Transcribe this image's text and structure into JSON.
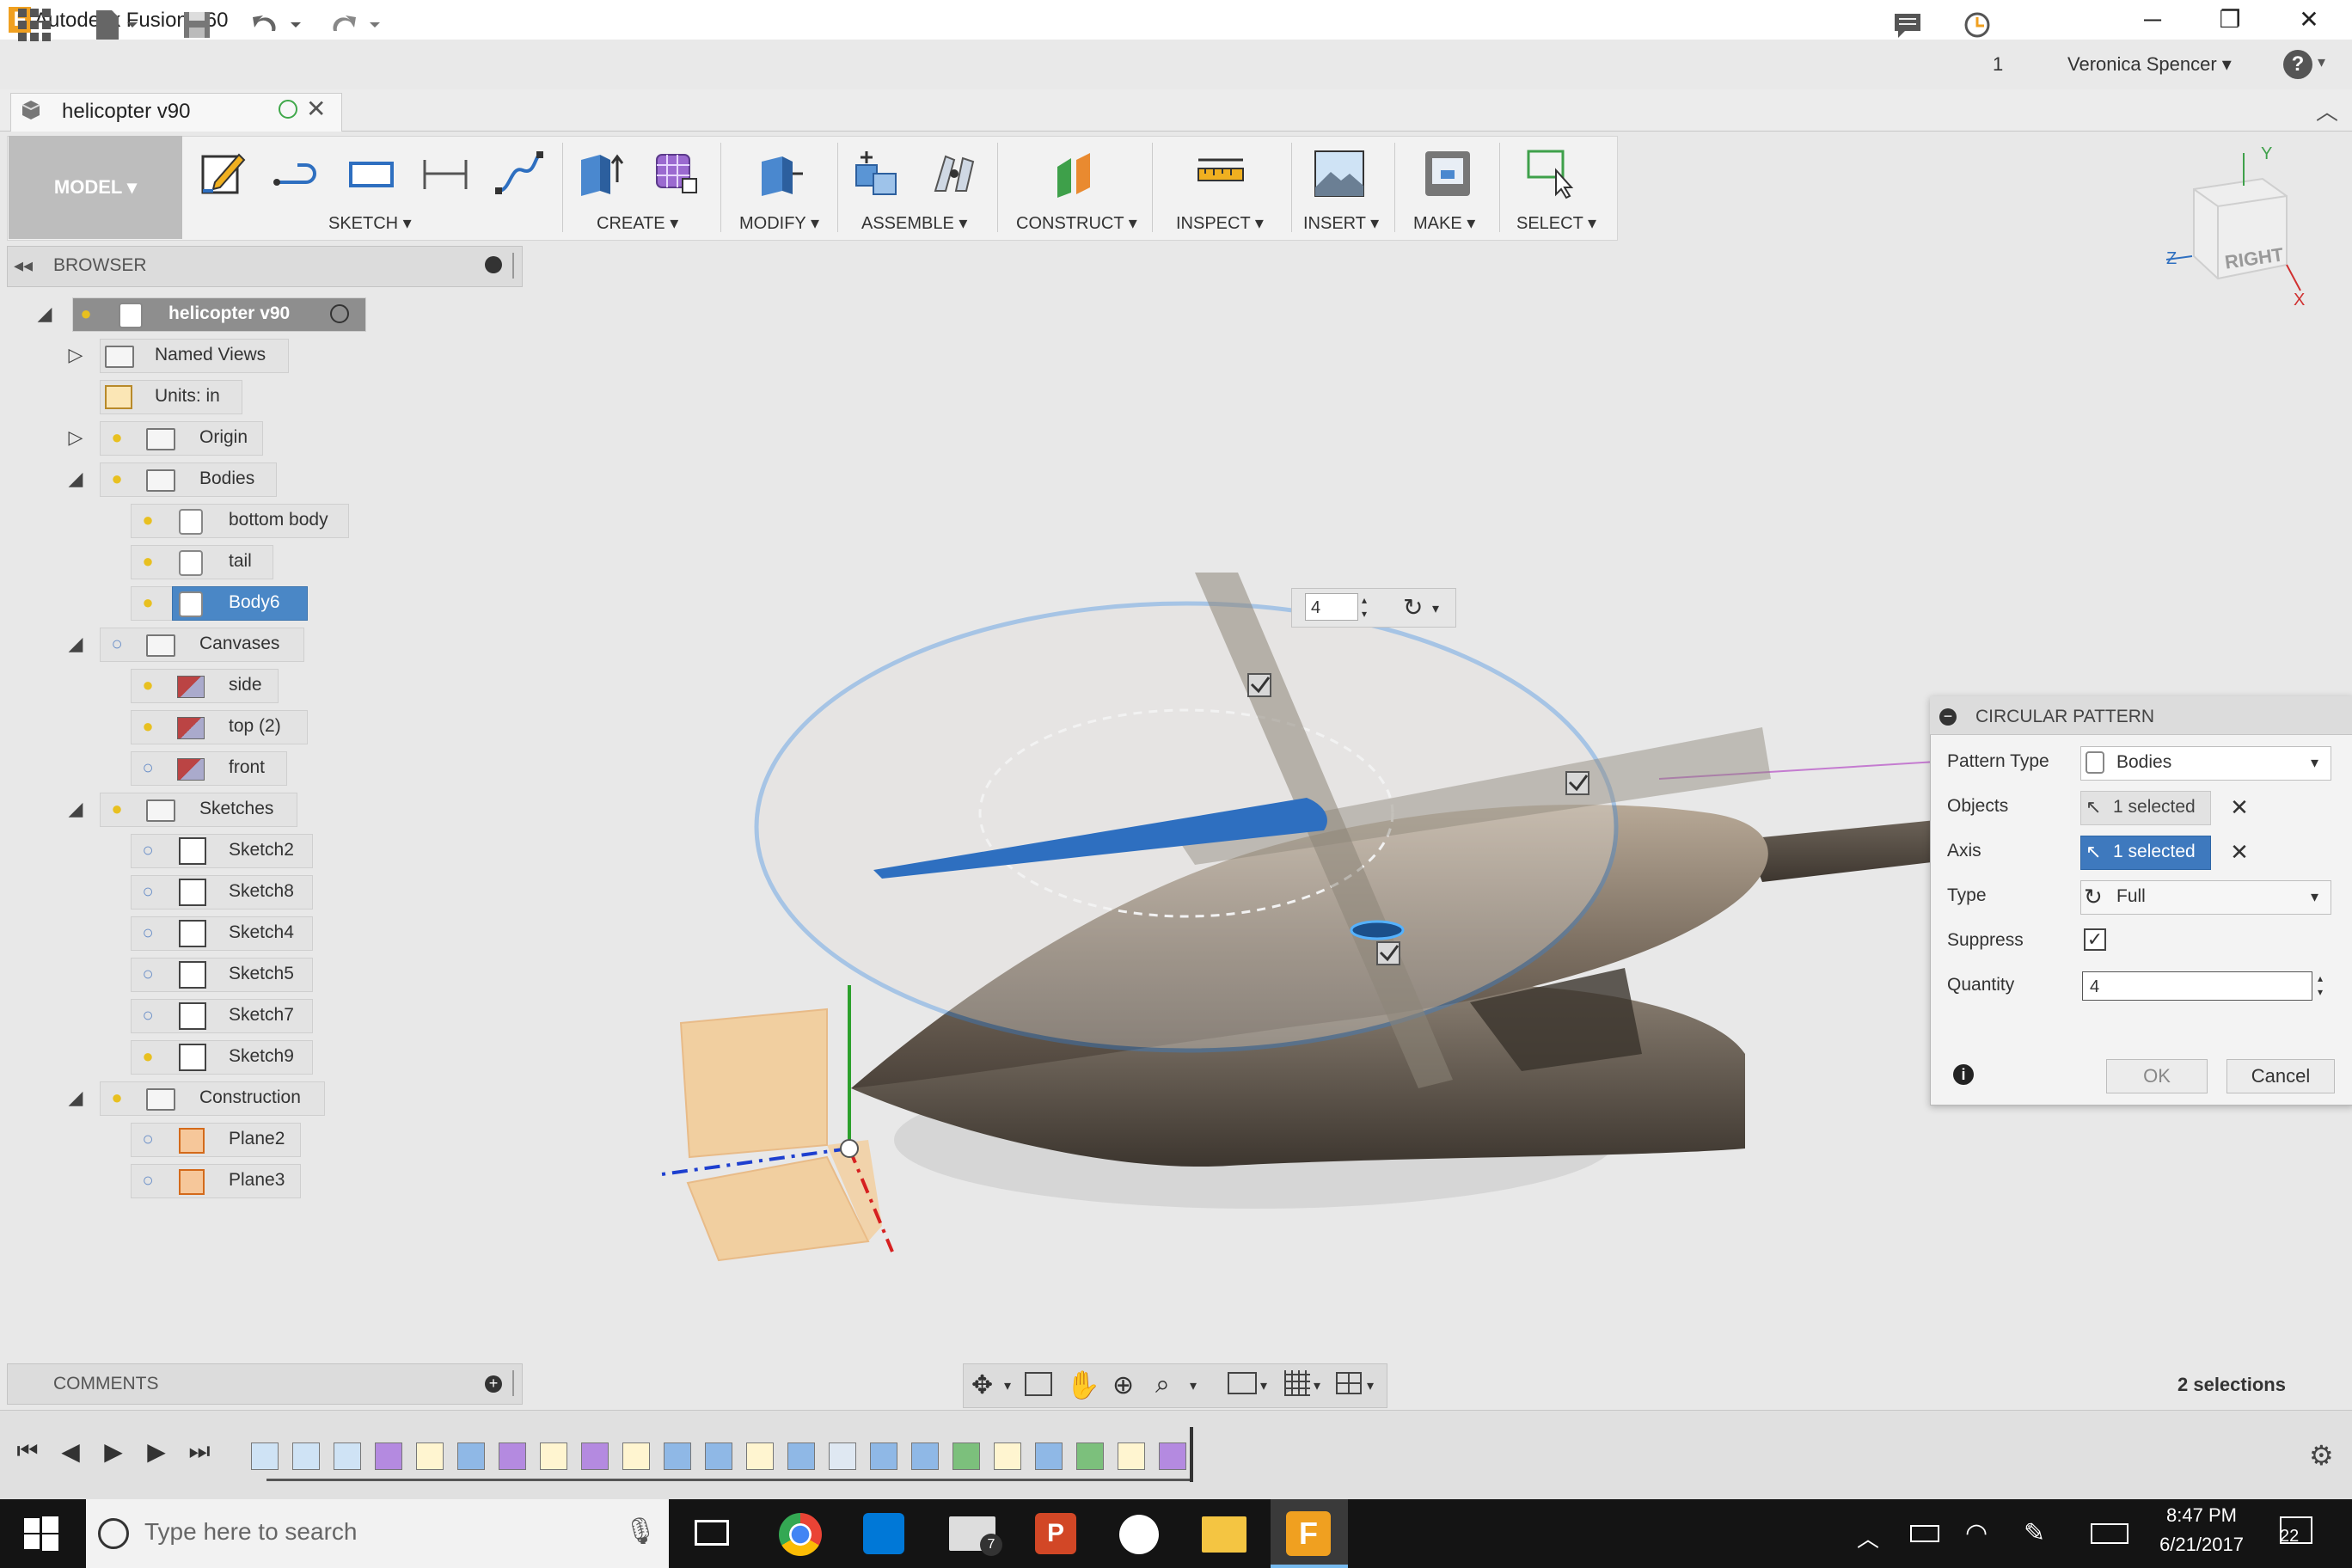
{
  "window": {
    "title": "Autodesk Fusion 360",
    "minimize": "─",
    "restore": "❐",
    "close": "✕"
  },
  "appbar": {
    "jobs_count": "1",
    "user_name": "Veronica Spencer ▾",
    "help": "?"
  },
  "document": {
    "tab_label": "helicopter v90"
  },
  "toolbar": {
    "workspace": "MODEL ▾",
    "groups": [
      "SKETCH ▾",
      "CREATE ▾",
      "MODIFY ▾",
      "ASSEMBLE ▾",
      "CONSTRUCT ▾",
      "INSPECT ▾",
      "INSERT ▾",
      "MAKE ▾",
      "SELECT ▾"
    ]
  },
  "viewcube": {
    "face": "RIGHT",
    "axis_y": "Y",
    "axis_z": "Z",
    "axis_x": "X"
  },
  "browser": {
    "title": "BROWSER",
    "root": "helicopter v90",
    "nodes": {
      "named_views": "Named Views",
      "units": "Units: in",
      "origin": "Origin",
      "bodies": "Bodies",
      "bottom_body": "bottom body",
      "tail": "tail",
      "body6": "Body6",
      "canvases": "Canvases",
      "side": "side",
      "top2": "top (2)",
      "front": "front",
      "sketches": "Sketches",
      "sketch2": "Sketch2",
      "sketch8": "Sketch8",
      "sketch4": "Sketch4",
      "sketch5": "Sketch5",
      "sketch7": "Sketch7",
      "sketch9": "Sketch9",
      "construction": "Construction",
      "plane2": "Plane2",
      "plane3": "Plane3"
    }
  },
  "comments": {
    "title": "COMMENTS"
  },
  "canvas_input": {
    "quantity_value": "4"
  },
  "dialog": {
    "title": "CIRCULAR PATTERN",
    "pattern_type_label": "Pattern Type",
    "pattern_type_value": "Bodies",
    "objects_label": "Objects",
    "objects_value": "1 selected",
    "axis_label": "Axis",
    "axis_value": "1 selected",
    "type_label": "Type",
    "type_value": "Full",
    "suppress_label": "Suppress",
    "quantity_label": "Quantity",
    "quantity_value": "4",
    "ok": "OK",
    "cancel": "Cancel"
  },
  "status": {
    "selections": "2 selections"
  },
  "taskbar": {
    "search_placeholder": "Type here to search",
    "time": "8:47 PM",
    "date": "6/21/2017",
    "notifications": "22",
    "mail_badge": "7"
  },
  "colors": {
    "accent": "#3e79be",
    "toolbar_bg": "#f2f2f2",
    "taskbar": "#141414",
    "selection_blue": "#4a87c6"
  }
}
